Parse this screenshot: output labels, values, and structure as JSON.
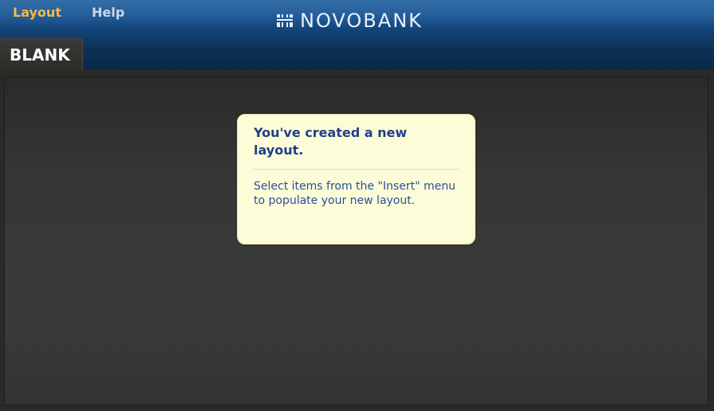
{
  "menu": {
    "items": [
      {
        "label": "Layout",
        "active": true
      },
      {
        "label": "Help",
        "active": false
      }
    ]
  },
  "brand": {
    "name": "NOVOBANK",
    "icon": "novobank-logo-icon"
  },
  "tabs": [
    {
      "label": "BLANK",
      "active": true
    }
  ],
  "card": {
    "title": "You've created a new layout.",
    "body": "Select items from the \"Insert\" menu to populate your new layout."
  },
  "colors": {
    "accent": "#f7b84a",
    "header_blue": "#1a5797",
    "card_bg": "#fdfcd8",
    "card_title": "#1f3f8a",
    "card_body": "#2b4f9a"
  }
}
